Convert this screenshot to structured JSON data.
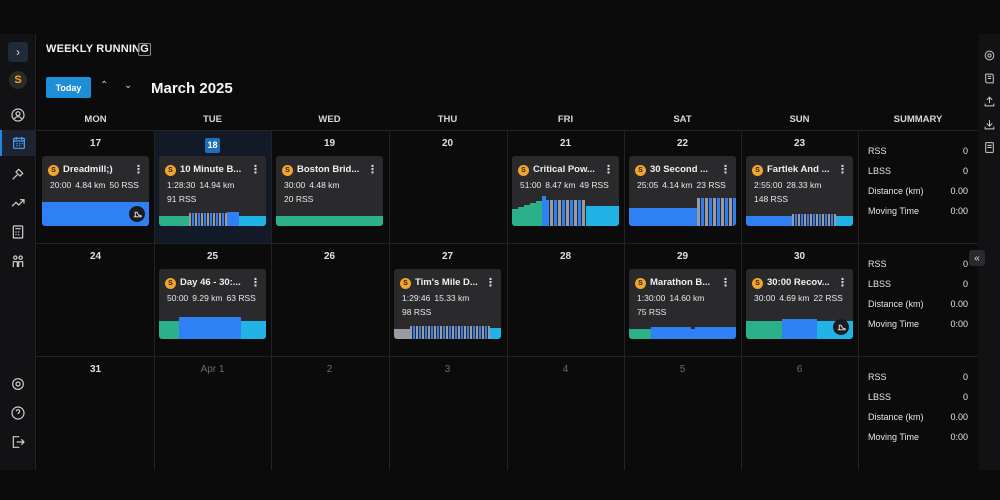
{
  "header": {
    "view_title": "WEEKLY RUNNING",
    "today_label": "Today",
    "month_title": "March 2025"
  },
  "columns": [
    "MON",
    "TUE",
    "WED",
    "THU",
    "FRI",
    "SAT",
    "SUN"
  ],
  "summary_label": "SUMMARY",
  "weeks": [
    {
      "days": [
        {
          "num": "17"
        },
        {
          "num": "18",
          "today": true
        },
        {
          "num": "19"
        },
        {
          "num": "20"
        },
        {
          "num": "21"
        },
        {
          "num": "22"
        },
        {
          "num": "23"
        }
      ],
      "summary": [
        {
          "label": "RSS",
          "value": "0"
        },
        {
          "label": "LBSS",
          "value": "0"
        },
        {
          "label": "Distance (km)",
          "value": "0.00"
        },
        {
          "label": "Moving Time",
          "value": "0:00"
        }
      ]
    },
    {
      "days": [
        {
          "num": "24"
        },
        {
          "num": "25"
        },
        {
          "num": "26"
        },
        {
          "num": "27"
        },
        {
          "num": "28"
        },
        {
          "num": "29"
        },
        {
          "num": "30"
        }
      ],
      "summary": [
        {
          "label": "RSS",
          "value": "0"
        },
        {
          "label": "LBSS",
          "value": "0"
        },
        {
          "label": "Distance (km)",
          "value": "0.00"
        },
        {
          "label": "Moving Time",
          "value": "0:00"
        }
      ]
    },
    {
      "days": [
        {
          "num": "31"
        },
        {
          "num": "Apr  1",
          "muted": true
        },
        {
          "num": "2",
          "muted": true
        },
        {
          "num": "3",
          "muted": true
        },
        {
          "num": "4",
          "muted": true
        },
        {
          "num": "5",
          "muted": true
        },
        {
          "num": "6",
          "muted": true
        }
      ],
      "summary": [
        {
          "label": "RSS",
          "value": "0"
        },
        {
          "label": "LBSS",
          "value": "0"
        },
        {
          "label": "Distance (km)",
          "value": "0.00"
        },
        {
          "label": "Moving Time",
          "value": "0:00"
        }
      ]
    }
  ],
  "workouts": [
    {
      "week": 0,
      "day": 0,
      "title": "Dreadmill;)",
      "time": "20:00",
      "distance": "4.84 km",
      "rss": "50 RSS",
      "rss_line": "",
      "shoe": true,
      "graph": "steady"
    },
    {
      "week": 0,
      "day": 1,
      "title": "10 Minute B...",
      "time": "1:28:30",
      "distance": "14.94 km",
      "rss": "",
      "rss_line": "91 RSS",
      "graph": "intervals-a"
    },
    {
      "week": 0,
      "day": 2,
      "title": "Boston Brid...",
      "time": "30:00",
      "distance": "4.48 km",
      "rss": "",
      "rss_line": "20 RSS",
      "graph": "green"
    },
    {
      "week": 0,
      "day": 4,
      "title": "Critical Pow...",
      "time": "51:00",
      "distance": "8.47 km",
      "rss": "49 RSS",
      "rss_line": "",
      "graph": "critical"
    },
    {
      "week": 0,
      "day": 5,
      "title": "30 Second ...",
      "time": "25:05",
      "distance": "4.14 km",
      "rss": "23 RSS",
      "rss_line": "",
      "graph": "thirty"
    },
    {
      "week": 0,
      "day": 6,
      "title": "Fartlek And ...",
      "time": "2:55:00",
      "distance": "28.33 km",
      "rss": "",
      "rss_line": "148 RSS",
      "graph": "fartlek"
    },
    {
      "week": 1,
      "day": 1,
      "title": "Day 46 - 30:...",
      "time": "50:00",
      "distance": "9.29 km",
      "rss": "63 RSS",
      "rss_line": "",
      "graph": "blocks"
    },
    {
      "week": 1,
      "day": 3,
      "title": "Tim's Mile D...",
      "time": "1:29:46",
      "distance": "15.33 km",
      "rss": "",
      "rss_line": "98 RSS",
      "graph": "miles"
    },
    {
      "week": 1,
      "day": 5,
      "title": "Marathon B...",
      "time": "1:30:00",
      "distance": "14.60 km",
      "rss": "",
      "rss_line": "75 RSS",
      "graph": "marathon"
    },
    {
      "week": 1,
      "day": 6,
      "title": "30:00 Recov...",
      "time": "30:00",
      "distance": "4.69 km",
      "rss": "22 RSS",
      "rss_line": "",
      "shoe": true,
      "graph": "recovery"
    }
  ],
  "colors": {
    "accent": "#1e8fd6",
    "graph_blue": "#2f7ff5",
    "graph_green": "#2bb08a",
    "graph_cyan": "#21b3e6",
    "graph_grey": "#9a9aa3",
    "logo_orange": "#f3a52c"
  },
  "icons": {
    "left_nav": [
      "expand-icon",
      "profile-icon",
      "calendar-icon",
      "tools-icon",
      "trending-icon",
      "calculator-icon",
      "team-icon",
      "settings-icon",
      "help-icon",
      "logout-icon"
    ],
    "right_nav": [
      "gear-icon",
      "book-icon",
      "upload-icon",
      "download-icon",
      "archive-icon"
    ]
  }
}
